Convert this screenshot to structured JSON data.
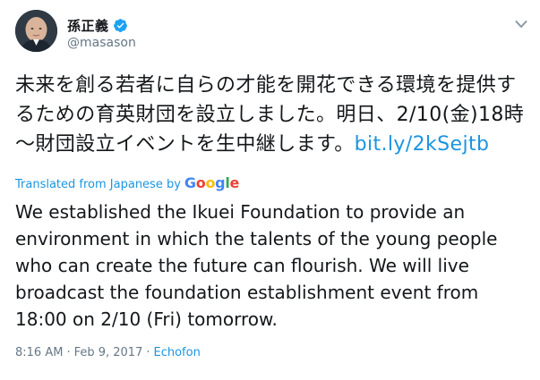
{
  "user": {
    "display_name": "孫正義",
    "username": "@masason"
  },
  "tweet": {
    "jp_lines": [
      "未来を創る若者に自らの才能を開花できる環境を提供す",
      "るための育英財団を設立しました。明日、2/10(金)18時",
      "〜財団設立イベントを生中継します。"
    ],
    "jp_link": "bit.ly/2kSejtb",
    "translated_label": "Translated from Japanese by",
    "google_logo_text": "Google",
    "en_lines": [
      "We established the Ikuei Foundation to provide an",
      "environment in which the talents of the young people",
      "who can create the future can flourish. We will live",
      "broadcast the foundation establishment event from",
      "18:00 on 2/10 (Fri) tomorrow."
    ]
  },
  "meta": {
    "time": "8:16 AM",
    "date": "Feb 9, 2017",
    "separator": "·",
    "client": "Echofon"
  },
  "icons": {
    "verified": "verified-badge-icon",
    "menu": "chevron-down-icon"
  },
  "colors": {
    "link": "#1b95e0",
    "verified": "#1da1f2",
    "secondary_text": "#657786"
  }
}
